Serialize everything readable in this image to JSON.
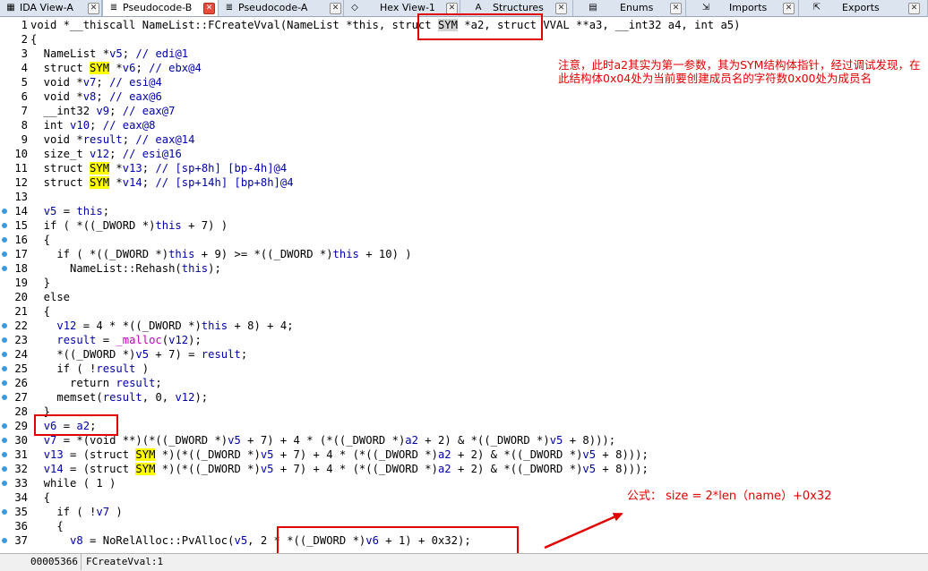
{
  "tabs": [
    {
      "label": "IDA View-A",
      "icon": "ida-view-icon",
      "active": false
    },
    {
      "label": "Pseudocode-B",
      "icon": "pseudocode-icon",
      "active": true
    },
    {
      "label": "Pseudocode-A",
      "icon": "pseudocode-icon",
      "active": false
    },
    {
      "label": "Hex View-1",
      "icon": "hex-view-icon",
      "active": false
    },
    {
      "label": "Structures",
      "icon": "structures-icon",
      "active": false
    },
    {
      "label": "Enums",
      "icon": "enums-icon",
      "active": false
    },
    {
      "label": "Imports",
      "icon": "imports-icon",
      "active": false
    },
    {
      "label": "Exports",
      "icon": "exports-icon",
      "active": false
    }
  ],
  "code": {
    "lines": [
      {
        "n": "1",
        "t": "void *__thiscall NameList::FCreateVval(NameList *this, struct SYM *a2, struct VVAL **a3, __int32 a4, int a5)"
      },
      {
        "n": "2",
        "t": "{"
      },
      {
        "n": "3",
        "t": "  NameList *v5; // edi@1"
      },
      {
        "n": "4",
        "t": "  struct SYM *v6; // ebx@4"
      },
      {
        "n": "5",
        "t": "  void *v7; // esi@4"
      },
      {
        "n": "6",
        "t": "  void *v8; // eax@6"
      },
      {
        "n": "7",
        "t": "  __int32 v9; // eax@7"
      },
      {
        "n": "8",
        "t": "  int v10; // eax@8"
      },
      {
        "n": "9",
        "t": "  void *result; // eax@14"
      },
      {
        "n": "10",
        "t": "  size_t v12; // esi@16"
      },
      {
        "n": "11",
        "t": "  struct SYM *v13; // [sp+8h] [bp-4h]@4"
      },
      {
        "n": "12",
        "t": "  struct SYM *v14; // [sp+14h] [bp+8h]@4"
      },
      {
        "n": "13",
        "t": ""
      },
      {
        "n": "14",
        "t": "  v5 = this;"
      },
      {
        "n": "15",
        "t": "  if ( *((_DWORD *)this + 7) )"
      },
      {
        "n": "16",
        "t": "  {"
      },
      {
        "n": "17",
        "t": "    if ( *((_DWORD *)this + 9) >= *((_DWORD *)this + 10) )"
      },
      {
        "n": "18",
        "t": "      NameList::Rehash(this);"
      },
      {
        "n": "19",
        "t": "  }"
      },
      {
        "n": "20",
        "t": "  else"
      },
      {
        "n": "21",
        "t": "  {"
      },
      {
        "n": "22",
        "t": "    v12 = 4 * *((_DWORD *)this + 8) + 4;"
      },
      {
        "n": "23",
        "t": "    result = _malloc(v12);"
      },
      {
        "n": "24",
        "t": "    *((_DWORD *)v5 + 7) = result;"
      },
      {
        "n": "25",
        "t": "    if ( !result )"
      },
      {
        "n": "26",
        "t": "      return result;"
      },
      {
        "n": "27",
        "t": "    memset(result, 0, v12);"
      },
      {
        "n": "28",
        "t": "  }"
      },
      {
        "n": "29",
        "t": "  v6 = a2;"
      },
      {
        "n": "30",
        "t": "  v7 = *(void **)(*((_DWORD *)v5 + 7) + 4 * (*((_DWORD *)a2 + 2) & *((_DWORD *)v5 + 8)));"
      },
      {
        "n": "31",
        "t": "  v13 = (struct SYM *)(*((_DWORD *)v5 + 7) + 4 * (*((_DWORD *)a2 + 2) & *((_DWORD *)v5 + 8)));"
      },
      {
        "n": "32",
        "t": "  v14 = (struct SYM *)(*((_DWORD *)v5 + 7) + 4 * (*((_DWORD *)a2 + 2) & *((_DWORD *)v5 + 8)));"
      },
      {
        "n": "33",
        "t": "  while ( 1 )"
      },
      {
        "n": "34",
        "t": "  {"
      },
      {
        "n": "35",
        "t": "    if ( !v7 )"
      },
      {
        "n": "36",
        "t": "    {"
      },
      {
        "n": "37",
        "t": "      v8 = NoRelAlloc::PvAlloc(v5, 2 * *((_DWORD *)v6 + 1) + 0x32);"
      }
    ],
    "dots": [
      "14",
      "15",
      "16",
      "17",
      "18",
      "22",
      "23",
      "24",
      "25",
      "26",
      "27",
      "29",
      "30",
      "31",
      "32",
      "33",
      "35",
      "37"
    ]
  },
  "annotations": {
    "note": "注意，此时a2其实为第一参数，其为SYM结构体指针，经过调试发现，在此结构体0x04处为当前要创建成员名的字符数0x00处为成员名",
    "formula": "公式：  size = 2*len（name）+0x32"
  },
  "status": {
    "address": "00005366",
    "location": "FCreateVval:1"
  },
  "colors": {
    "annotation": "#e00000",
    "highlight": "#ffff00",
    "variable": "#0000a8",
    "breakpoint_dot": "#3b9be0"
  }
}
